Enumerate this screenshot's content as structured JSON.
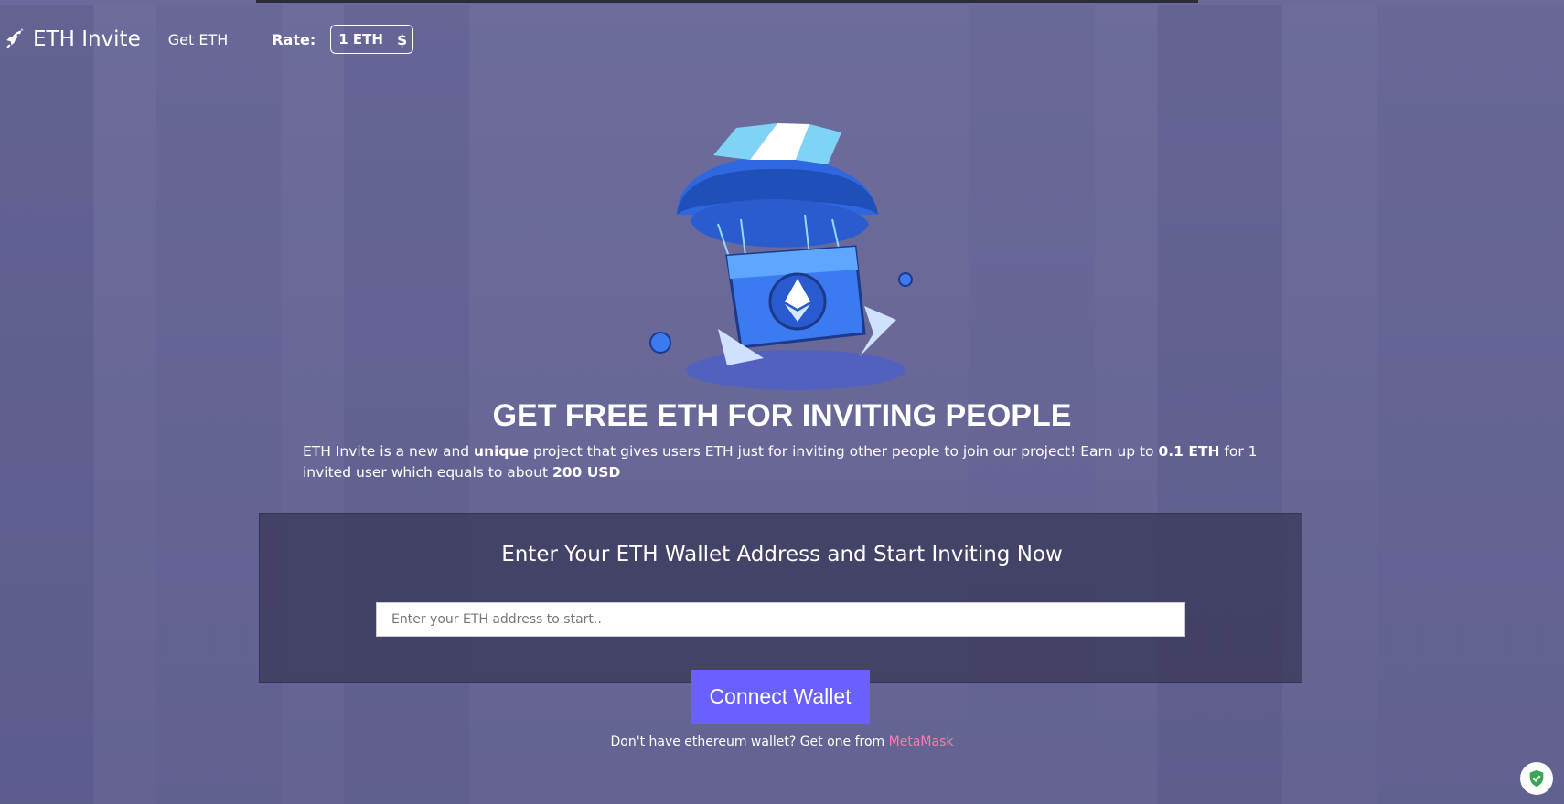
{
  "header": {
    "brand": "ETH Invite",
    "nav_get_eth": "Get ETH",
    "rate_label": "Rate:",
    "rate_eth": "1 ETH",
    "rate_usd": "$"
  },
  "hero": {
    "headline": "GET FREE ETH FOR INVITING PEOPLE",
    "desc_part1": "ETH Invite is a new and ",
    "desc_bold1": "unique",
    "desc_part2": " project that gives users ETH just for inviting other people to join our project! Earn up to ",
    "desc_bold2": "0.1 ETH",
    "desc_part3": " for 1 invited user which equals to about ",
    "desc_bold3": "200 USD"
  },
  "panel": {
    "title": "Enter Your ETH Wallet Address and Start Inviting Now",
    "input_placeholder": "Enter your ETH address to start..",
    "input_value": ""
  },
  "connect_button": "Connect Wallet",
  "footnote": {
    "text": "Don't have ethereum wallet? Get one from ",
    "link": "MetaMask"
  },
  "colors": {
    "background": "#6b6a9a",
    "button": "#6a5fff",
    "link": "#ff7aa8"
  },
  "icons": [
    "rocket-icon",
    "parachute-eth-crate-illustration",
    "shield-check-icon"
  ]
}
